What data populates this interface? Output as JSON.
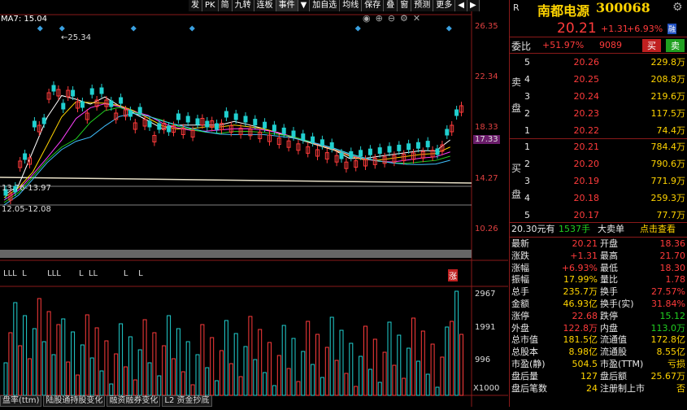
{
  "toolbar": [
    "发",
    "PK",
    "简",
    "九转",
    "连板",
    "事件",
    "▼",
    "加自选",
    "均线",
    "保存",
    "叠",
    "窗",
    "预测",
    "更多",
    "◀",
    "▶"
  ],
  "stock": {
    "name": "南都电源",
    "code": "300068",
    "price": "20.21",
    "change": "+1.31",
    "change_pct": "+6.93%",
    "badge": "融",
    "ratio_label": "委比",
    "ratio": "+51.97%",
    "diff": "9089",
    "sell_btn": "买",
    "buy_btn": "卖",
    "r_icon": "R",
    "gear": "⚙"
  },
  "ma_label": "MA7: 15.04",
  "chart_annotations": {
    "high": "25.34",
    "range1": "13.76-13.97",
    "range2": "12.05-12.08",
    "bottom_marks": "LLL  L        LLL       L  LL          L    L",
    "zhang": "涨"
  },
  "price_axis": [
    "26.35",
    "22.34",
    "18.33",
    "17.33",
    "14.27",
    "10.26"
  ],
  "volume_axis": [
    "2967",
    "1991",
    "996",
    "X1000"
  ],
  "sell_orders": [
    {
      "level": "5",
      "price": "20.26",
      "vol": "229.8万"
    },
    {
      "level": "4",
      "price": "20.25",
      "vol": "208.8万"
    },
    {
      "level": "3",
      "price": "20.24",
      "vol": "219.6万"
    },
    {
      "level": "2",
      "price": "20.23",
      "vol": "117.5万"
    },
    {
      "level": "1",
      "price": "20.22",
      "vol": "74.4万"
    }
  ],
  "buy_orders": [
    {
      "level": "1",
      "price": "20.21",
      "vol": "784.4万"
    },
    {
      "level": "2",
      "price": "20.20",
      "vol": "790.6万"
    },
    {
      "level": "3",
      "price": "20.19",
      "vol": "771.9万"
    },
    {
      "level": "4",
      "price": "20.18",
      "vol": "259.3万"
    },
    {
      "level": "5",
      "price": "20.17",
      "vol": "77.7万"
    }
  ],
  "sell_side_label": [
    "卖",
    "盘"
  ],
  "buy_side_label": [
    "买",
    "盘"
  ],
  "trade_line": {
    "price": "20.30元有",
    "hands": "1537手",
    "big": "大卖单",
    "check": "点击查看"
  },
  "stats": [
    {
      "l1": "最新",
      "v1": "20.21",
      "l2": "开盘",
      "v2": "18.36"
    },
    {
      "l1": "涨跌",
      "v1": "+1.31",
      "l2": "最高",
      "v2": "21.70"
    },
    {
      "l1": "涨幅",
      "v1": "+6.93%",
      "l2": "最低",
      "v2": "18.30"
    },
    {
      "l1": "振幅",
      "v1": "17.99%",
      "l2": "量比",
      "v2": "1.78"
    },
    {
      "l1": "总手",
      "v1": "235.7万",
      "l2": "换手",
      "v2": "27.57%"
    },
    {
      "l1": "金额",
      "v1": "46.93亿",
      "l2": "换手(实)",
      "v2": "31.84%"
    },
    {
      "l1": "涨停",
      "v1": "22.68",
      "l2": "跌停",
      "v2": "15.12"
    },
    {
      "l1": "外盘",
      "v1": "122.8万",
      "l2": "内盘",
      "v2": "113.0万"
    },
    {
      "l1": "总市值",
      "v1": "181.5亿",
      "l2": "流通值",
      "v2": "172.8亿"
    },
    {
      "l1": "总股本",
      "v1": "8.98亿",
      "l2": "流通股",
      "v2": "8.55亿"
    },
    {
      "l1": "市盈(静)",
      "v1": "504.5",
      "l2": "市盈(TTM)",
      "v2": "亏损"
    },
    {
      "l1": "盘后量",
      "v1": "127",
      "l2": "盘后额",
      "v2": "25.67万"
    },
    {
      "l1": "盘后笔数",
      "v1": "24",
      "l2": "注册制上市",
      "v2": "否"
    }
  ],
  "bottom_tabs": [
    "盘率(ttm)",
    "陆股通持股变化",
    "融资融券变化",
    "L2 资金抄底"
  ],
  "colors": {
    "up": "#ff3b3b",
    "down": "#21d0d0",
    "accent": "#8a1a1a"
  }
}
